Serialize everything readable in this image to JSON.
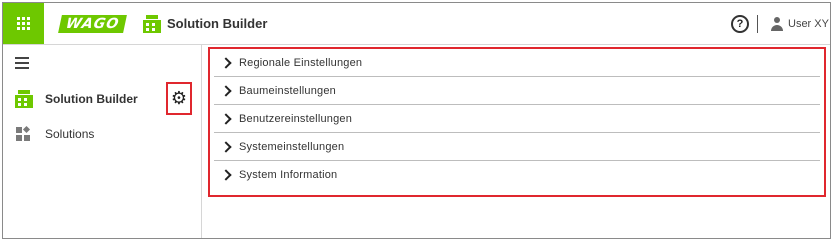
{
  "header": {
    "brand_logo": "WAGO",
    "app_title": "Solution Builder",
    "help_icon": "question-circle-icon",
    "help_glyph": "?",
    "user_name": "User XY",
    "accent_color": "#6ec800"
  },
  "sidebar": {
    "items": [
      {
        "label": "Solution Builder",
        "icon": "solution-builder-icon"
      },
      {
        "label": "Solutions",
        "icon": "solutions-icon"
      }
    ],
    "settings_icon": "gear-icon",
    "settings_glyph": "⚙"
  },
  "settings_menu": {
    "items": [
      {
        "label": "Regionale Einstellungen"
      },
      {
        "label": "Baumeinstellungen"
      },
      {
        "label": "Benutzereinstellungen"
      },
      {
        "label": "Systemeinstellungen"
      },
      {
        "label": "System Information"
      }
    ],
    "highlight_color": "#e0272e"
  }
}
